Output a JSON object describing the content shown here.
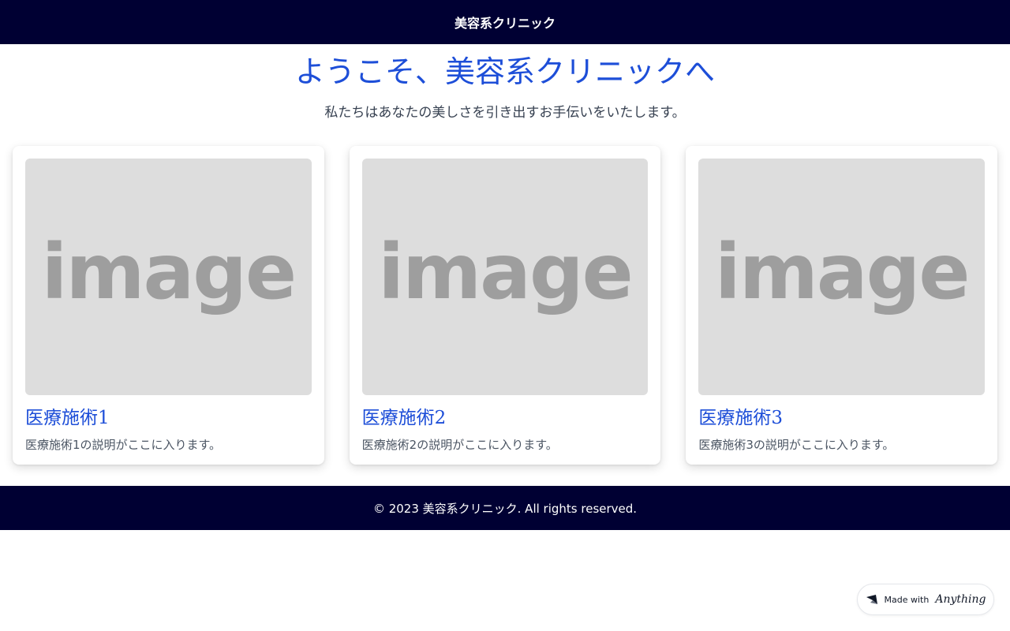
{
  "header": {
    "title": "美容系クリニック"
  },
  "hero": {
    "title": "ようこそ、美容系クリニックへ",
    "subtitle": "私たちはあなたの美しさを引き出すお手伝いをいたします。"
  },
  "cards": [
    {
      "image_text": "image",
      "title": "医療施術1",
      "description": "医療施術1の説明がここに入ります。"
    },
    {
      "image_text": "image",
      "title": "医療施術2",
      "description": "医療施術2の説明がここに入ります。"
    },
    {
      "image_text": "image",
      "title": "医療施術3",
      "description": "医療施術3の説明がここに入ります。"
    }
  ],
  "footer": {
    "text": "© 2023 美容系クリニック. All rights reserved."
  },
  "badge": {
    "prefix": "Made with",
    "brand": "Anything",
    "icon": "anything-logo-icon"
  },
  "colors": {
    "navy": "#000033",
    "accent_blue": "#1d4ed8",
    "placeholder_gray": "#dddddd"
  }
}
